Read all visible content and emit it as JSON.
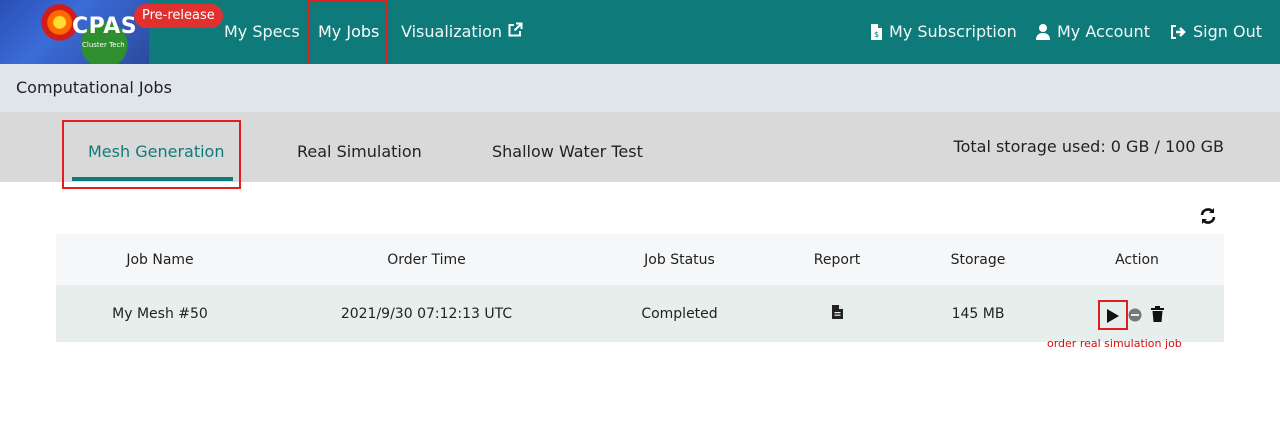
{
  "brand": {
    "logo_title": "CPAS",
    "logo_sub": "Cluster Tech",
    "badge": "Pre-release"
  },
  "nav": {
    "my_specs": "My Specs",
    "my_jobs": "My Jobs",
    "visualization": "Visualization",
    "my_subscription": "My Subscription",
    "my_account": "My Account",
    "sign_out": "Sign Out"
  },
  "breadcrumb": "Computational Jobs",
  "tabs": {
    "mesh": "Mesh Generation",
    "real": "Real Simulation",
    "shallow": "Shallow Water Test"
  },
  "storage_text": "Total storage used: 0 GB / 100 GB",
  "table": {
    "headers": [
      "Job Name",
      "Order Time",
      "Job Status",
      "Report",
      "Storage",
      "Action"
    ],
    "rows": [
      {
        "job_name": "My Mesh #50",
        "order_time": "2021/9/30 07:12:13 UTC",
        "status": "Completed",
        "report_icon": "file-icon",
        "storage": "145 MB",
        "actions": [
          "play-icon",
          "minus-circle-icon",
          "trash-icon"
        ]
      }
    ]
  },
  "annotation": "order real simulation job",
  "colors": {
    "primary": "#0e7a7a",
    "highlight": "#e02020",
    "badge": "#e03030",
    "row_bg": "#e7efed"
  }
}
